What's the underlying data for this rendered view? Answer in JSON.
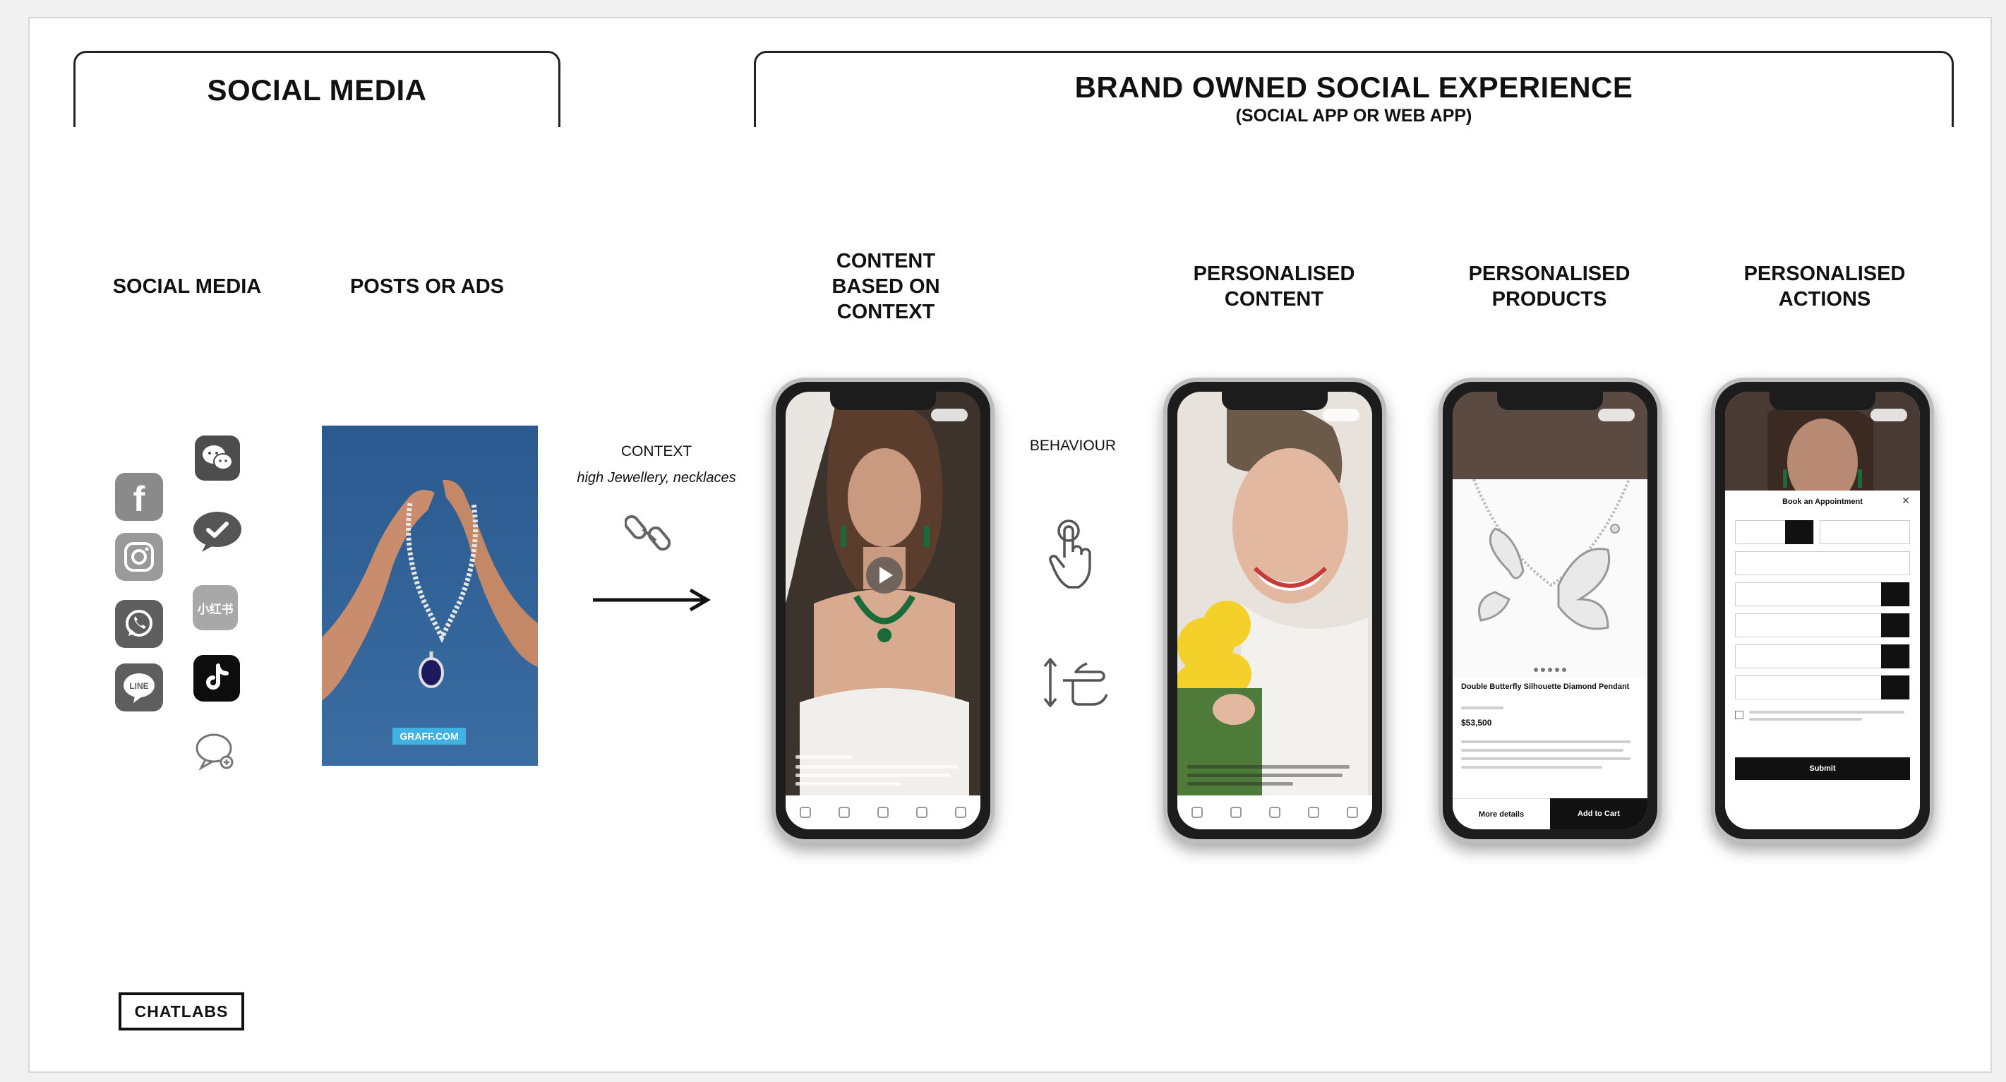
{
  "sections": {
    "social_media_title": "SOCIAL MEDIA",
    "brand_title": "BRAND OWNED SOCIAL EXPERIENCE",
    "brand_subtitle": "(SOCIAL APP OR WEB APP)"
  },
  "columns": {
    "social_media": "SOCIAL MEDIA",
    "posts_or_ads": "POSTS OR ADS",
    "content_based_on_context": "CONTENT\nBASED ON\nCONTEXT",
    "personalised_content": "PERSONALISED\nCONTENT",
    "personalised_products": "PERSONALISED\nPRODUCTS",
    "personalised_actions": "PERSONALISED\nACTIONS"
  },
  "context": {
    "label": "CONTEXT",
    "detail": "high Jewellery, necklaces"
  },
  "behaviour": {
    "label": "BEHAVIOUR"
  },
  "social_icons": [
    "facebook-icon",
    "instagram-icon",
    "whatsapp-icon",
    "line-icon",
    "wechat-icon",
    "kakaotalk-icon",
    "xiaohongshu-icon",
    "tiktok-icon",
    "chat-bubble-icon"
  ],
  "icon_labels": {
    "line": "LINE",
    "xiaohongshu": "小红书"
  },
  "ad": {
    "cta": "GRAFF.COM"
  },
  "product": {
    "name": "Double Butterfly Silhouette Diamond Pendant",
    "price": "$53,500",
    "more_details": "More details",
    "add_to_cart": "Add to Cart"
  },
  "appointment_form": {
    "title": "Book an Appointment",
    "submit": "Submit"
  },
  "brand": {
    "logo": "CHATLABS"
  },
  "colors": {
    "ad_background": "#2f5f93",
    "accent_dark": "#111111"
  }
}
